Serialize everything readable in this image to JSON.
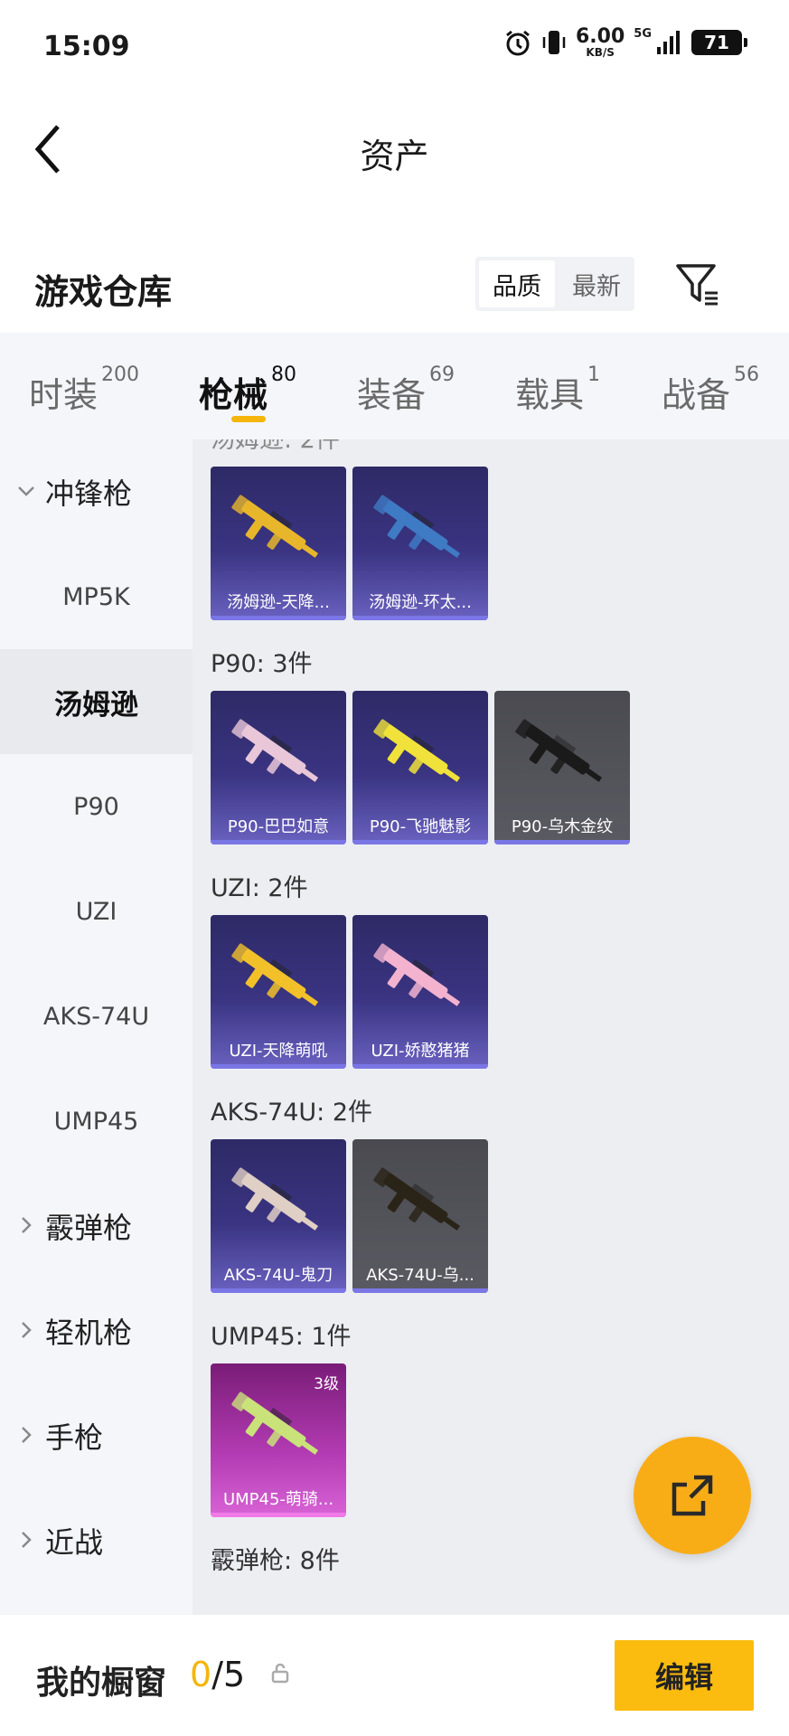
{
  "status_bar": {
    "time": "15:09",
    "net_speed": "6.00",
    "net_unit": "KB/S",
    "network": "5G",
    "battery": "71"
  },
  "header": {
    "title": "资产"
  },
  "warehouse": {
    "title": "游戏仓库",
    "sort_options": [
      "品质",
      "最新"
    ],
    "active_sort": "品质"
  },
  "tabs": [
    {
      "label": "时装",
      "count": "200"
    },
    {
      "label": "枪械",
      "count": "80"
    },
    {
      "label": "装备",
      "count": "69"
    },
    {
      "label": "载具",
      "count": "1"
    },
    {
      "label": "战备",
      "count": "56"
    }
  ],
  "active_tab": "枪械",
  "sidebar": {
    "items": [
      {
        "label": "冲锋枪",
        "type": "group",
        "expanded": true
      },
      {
        "label": "MP5K",
        "type": "sub"
      },
      {
        "label": "汤姆逊",
        "type": "sub",
        "active": true
      },
      {
        "label": "P90",
        "type": "sub"
      },
      {
        "label": "UZI",
        "type": "sub"
      },
      {
        "label": "AKS-74U",
        "type": "sub"
      },
      {
        "label": "UMP45",
        "type": "sub"
      },
      {
        "label": "霰弹枪",
        "type": "group"
      },
      {
        "label": "轻机枪",
        "type": "group"
      },
      {
        "label": "手枪",
        "type": "group"
      },
      {
        "label": "近战",
        "type": "group"
      }
    ]
  },
  "sections": [
    {
      "label": "",
      "items": [
        {
          "name": "汤姆逊-天降...",
          "rarity": "purple",
          "gun_color": "#e8b62a"
        },
        {
          "name": "汤姆逊-环太...",
          "rarity": "purple",
          "gun_color": "#3f7ac4"
        }
      ]
    },
    {
      "label": "P90: 3件",
      "items": [
        {
          "name": "P90-巴巴如意",
          "rarity": "purple",
          "gun_color": "#e9c7d8"
        },
        {
          "name": "P90-飞驰魅影",
          "rarity": "purple",
          "gun_color": "#f0e23a"
        },
        {
          "name": "P90-乌木金纹",
          "rarity": "gray",
          "gun_color": "#1a1a1a"
        }
      ]
    },
    {
      "label": "UZI: 2件",
      "items": [
        {
          "name": "UZI-天降萌吼",
          "rarity": "purple",
          "gun_color": "#f2c12a"
        },
        {
          "name": "UZI-娇憨猪猪",
          "rarity": "purple",
          "gun_color": "#f3b3cf"
        }
      ]
    },
    {
      "label": "AKS-74U: 2件",
      "items": [
        {
          "name": "AKS-74U-鬼刀",
          "rarity": "purple",
          "gun_color": "#e0cfc4"
        },
        {
          "name": "AKS-74U-乌...",
          "rarity": "gray",
          "gun_color": "#2a2418"
        }
      ]
    },
    {
      "label": "UMP45: 1件",
      "items": [
        {
          "name": "UMP45-萌骑...",
          "rarity": "pink",
          "gun_color": "#c9e27a",
          "level": "3级"
        }
      ]
    },
    {
      "label": "霰弹枪: 8件",
      "items": []
    }
  ],
  "bottom_bar": {
    "label": "我的橱窗",
    "current": "0",
    "separator": "/",
    "total": "5",
    "edit_label": "编辑"
  },
  "colors": {
    "accent": "#f5b50a",
    "purple_card": "#3a3482",
    "gray_card": "#55555c",
    "pink_card": "#b43cb4"
  }
}
